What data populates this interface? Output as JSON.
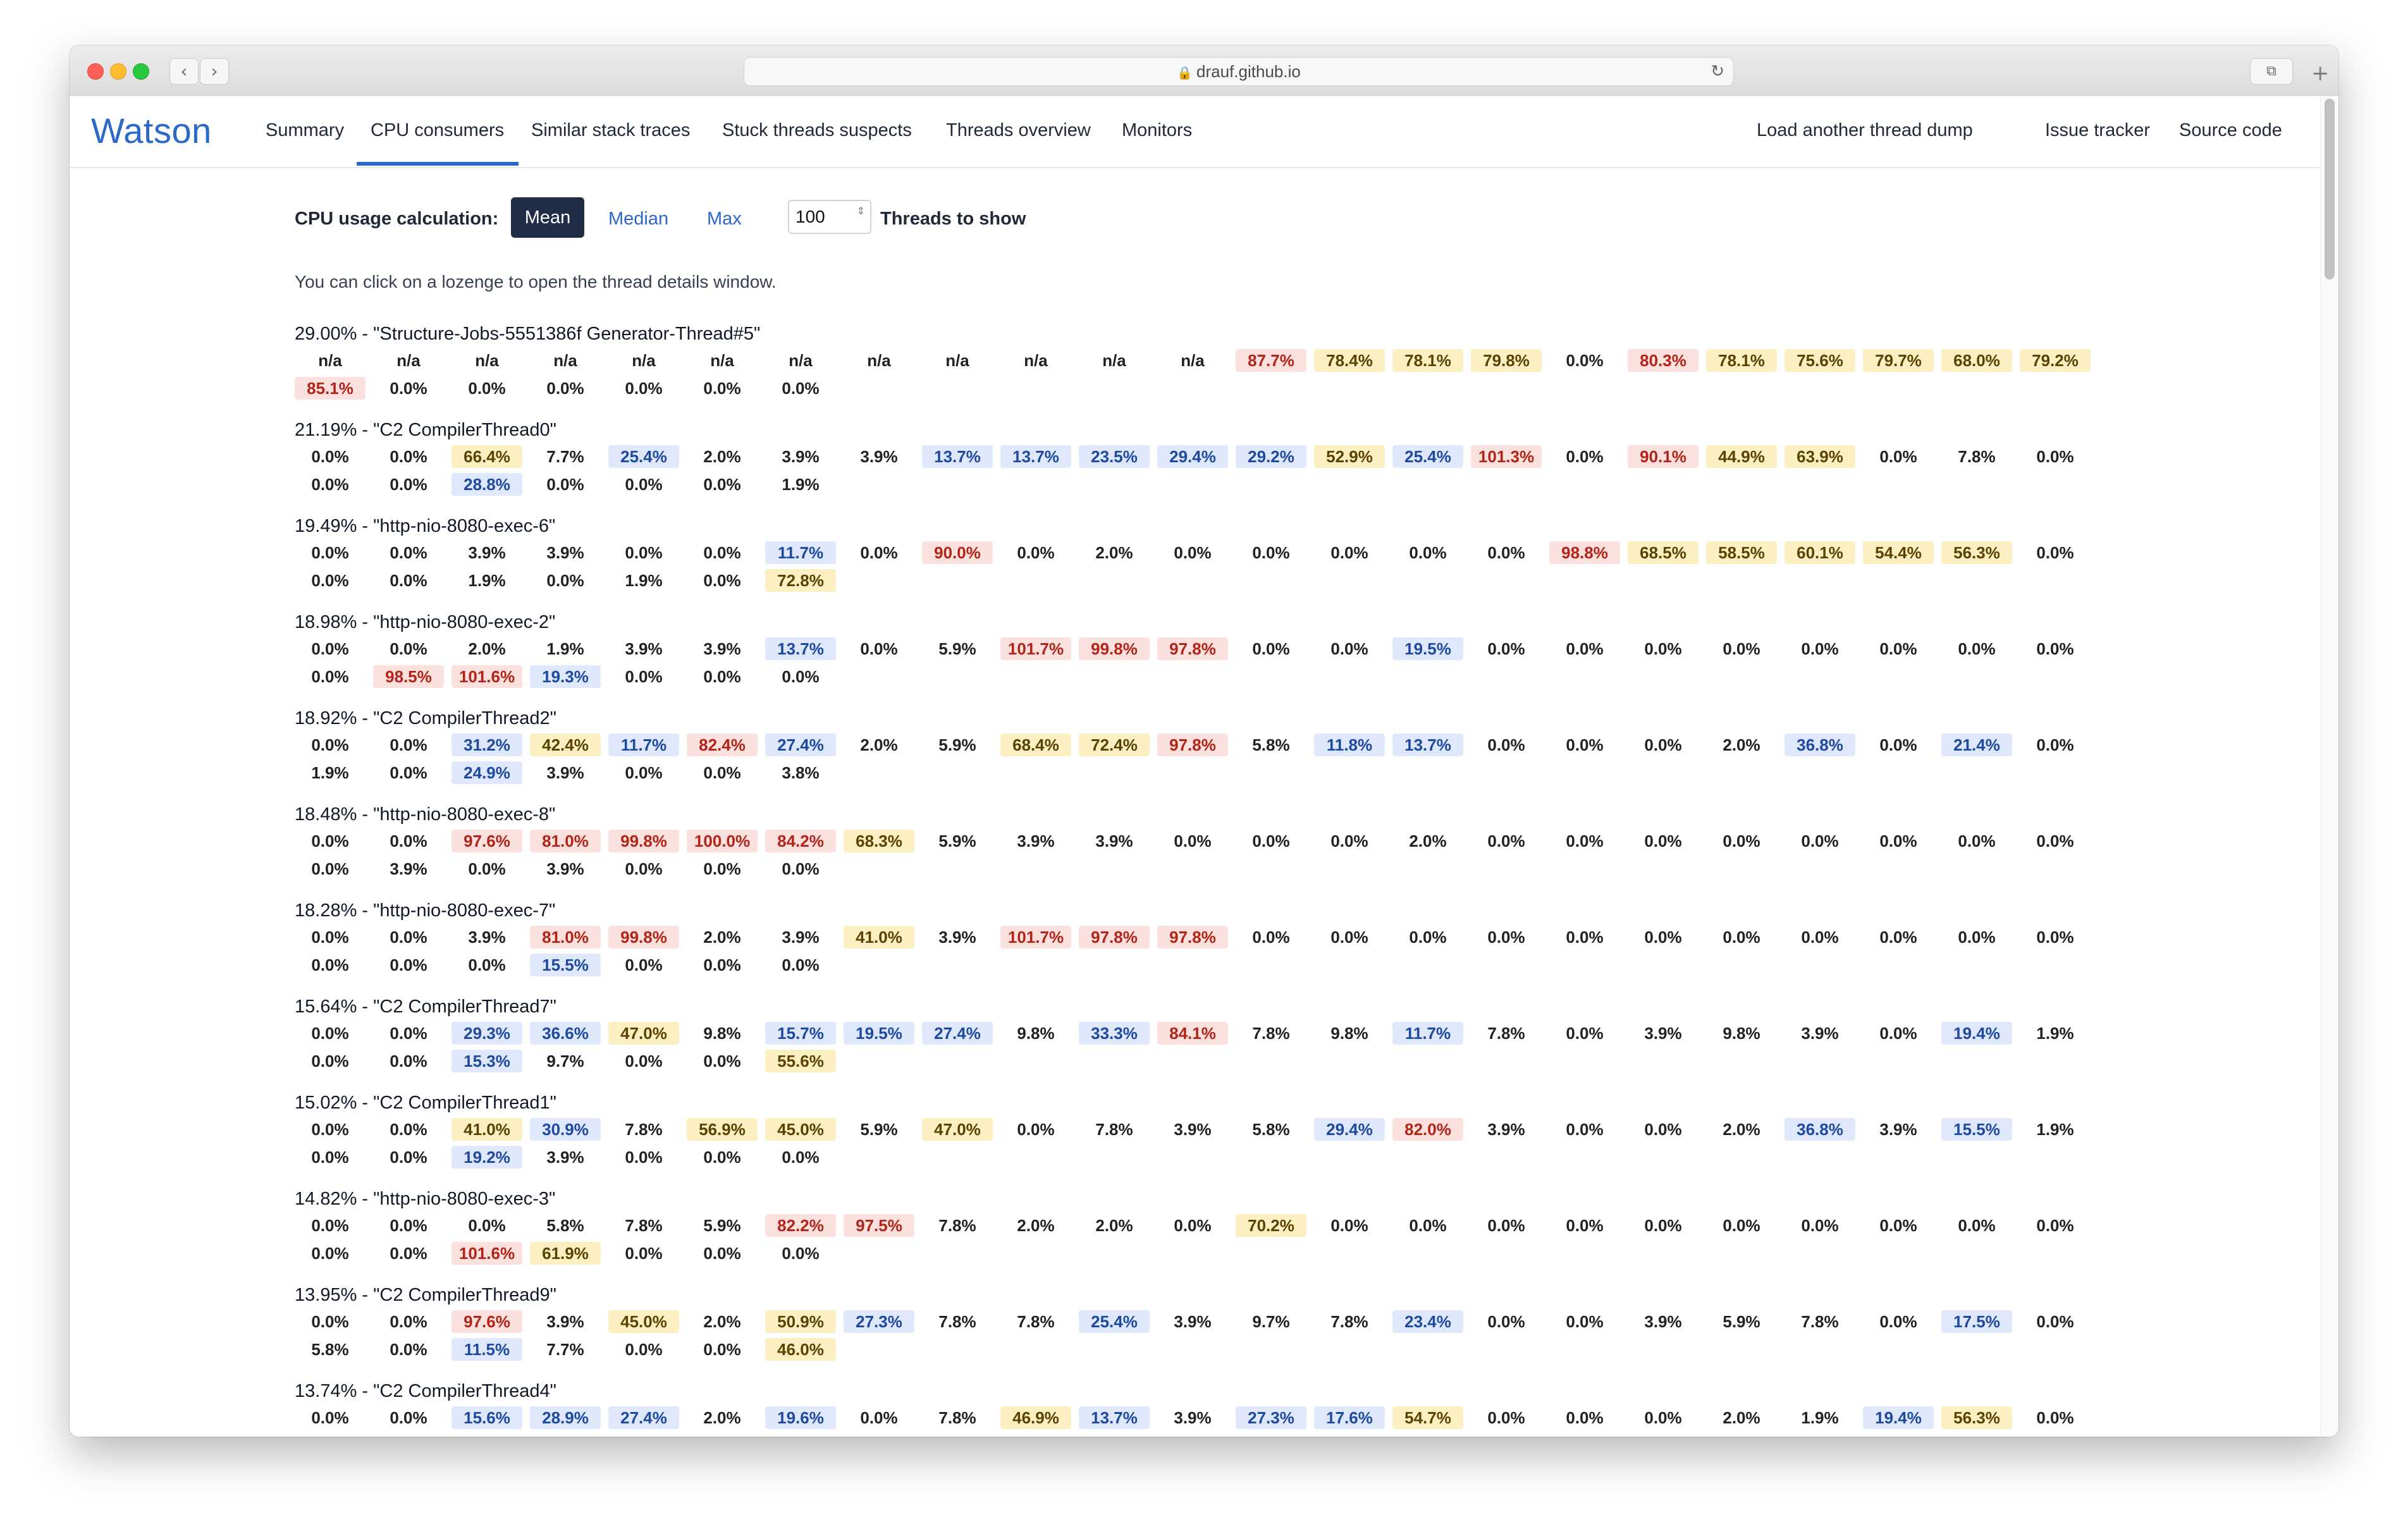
{
  "browser": {
    "url": "drauf.github.io",
    "back_icon": "‹",
    "forward_icon": "›",
    "reload_icon": "↻",
    "tabs_icon": "⧉",
    "new_tab_icon": "+",
    "lock_icon": "🔒"
  },
  "nav": {
    "brand": "Watson",
    "links": [
      "Summary",
      "CPU consumers",
      "Similar stack traces",
      "Stuck threads suspects",
      "Threads overview",
      "Monitors"
    ],
    "active": "CPU consumers",
    "right_links": [
      "Load another thread dump",
      "Issue tracker",
      "Source code"
    ]
  },
  "controls": {
    "label": "CPU usage calculation:",
    "options": [
      "Mean",
      "Median",
      "Max"
    ],
    "selected": "Mean",
    "threads_value": "100",
    "threads_label": "Threads to show",
    "stepper_icon": "⇕"
  },
  "hint": "You can click on a lozenge to open the thread details window.",
  "threads": [
    {
      "title": "29.00% - \"Structure-Jobs-5551386f Generator-Thread#5\"",
      "values": [
        "n/a",
        "n/a",
        "n/a",
        "n/a",
        "n/a",
        "n/a",
        "n/a",
        "n/a",
        "n/a",
        "n/a",
        "n/a",
        "n/a",
        "87.7%",
        "78.4%",
        "78.1%",
        "79.8%",
        "0.0%",
        "80.3%",
        "78.1%",
        "75.6%",
        "79.7%",
        "68.0%",
        "79.2%",
        "85.1%",
        "0.0%",
        "0.0%",
        "0.0%",
        "0.0%",
        "0.0%",
        "0.0%"
      ]
    },
    {
      "title": "21.19% - \"C2 CompilerThread0\"",
      "values": [
        "0.0%",
        "0.0%",
        "66.4%",
        "7.7%",
        "25.4%",
        "2.0%",
        "3.9%",
        "3.9%",
        "13.7%",
        "13.7%",
        "23.5%",
        "29.4%",
        "29.2%",
        "52.9%",
        "25.4%",
        "101.3%",
        "0.0%",
        "90.1%",
        "44.9%",
        "63.9%",
        "0.0%",
        "7.8%",
        "0.0%",
        "0.0%",
        "0.0%",
        "28.8%",
        "0.0%",
        "0.0%",
        "0.0%",
        "1.9%"
      ]
    },
    {
      "title": "19.49% - \"http-nio-8080-exec-6\"",
      "values": [
        "0.0%",
        "0.0%",
        "3.9%",
        "3.9%",
        "0.0%",
        "0.0%",
        "11.7%",
        "0.0%",
        "90.0%",
        "0.0%",
        "2.0%",
        "0.0%",
        "0.0%",
        "0.0%",
        "0.0%",
        "0.0%",
        "98.8%",
        "68.5%",
        "58.5%",
        "60.1%",
        "54.4%",
        "56.3%",
        "0.0%",
        "0.0%",
        "0.0%",
        "1.9%",
        "0.0%",
        "1.9%",
        "0.0%",
        "72.8%"
      ]
    },
    {
      "title": "18.98% - \"http-nio-8080-exec-2\"",
      "values": [
        "0.0%",
        "0.0%",
        "2.0%",
        "1.9%",
        "3.9%",
        "3.9%",
        "13.7%",
        "0.0%",
        "5.9%",
        "101.7%",
        "99.8%",
        "97.8%",
        "0.0%",
        "0.0%",
        "19.5%",
        "0.0%",
        "0.0%",
        "0.0%",
        "0.0%",
        "0.0%",
        "0.0%",
        "0.0%",
        "0.0%",
        "0.0%",
        "98.5%",
        "101.6%",
        "19.3%",
        "0.0%",
        "0.0%",
        "0.0%"
      ]
    },
    {
      "title": "18.92% - \"C2 CompilerThread2\"",
      "values": [
        "0.0%",
        "0.0%",
        "31.2%",
        "42.4%",
        "11.7%",
        "82.4%",
        "27.4%",
        "2.0%",
        "5.9%",
        "68.4%",
        "72.4%",
        "97.8%",
        "5.8%",
        "11.8%",
        "13.7%",
        "0.0%",
        "0.0%",
        "0.0%",
        "2.0%",
        "36.8%",
        "0.0%",
        "21.4%",
        "0.0%",
        "1.9%",
        "0.0%",
        "24.9%",
        "3.9%",
        "0.0%",
        "0.0%",
        "3.8%"
      ]
    },
    {
      "title": "18.48% - \"http-nio-8080-exec-8\"",
      "values": [
        "0.0%",
        "0.0%",
        "97.6%",
        "81.0%",
        "99.8%",
        "100.0%",
        "84.2%",
        "68.3%",
        "5.9%",
        "3.9%",
        "3.9%",
        "0.0%",
        "0.0%",
        "0.0%",
        "2.0%",
        "0.0%",
        "0.0%",
        "0.0%",
        "0.0%",
        "0.0%",
        "0.0%",
        "0.0%",
        "0.0%",
        "0.0%",
        "3.9%",
        "0.0%",
        "3.9%",
        "0.0%",
        "0.0%",
        "0.0%"
      ]
    },
    {
      "title": "18.28% - \"http-nio-8080-exec-7\"",
      "values": [
        "0.0%",
        "0.0%",
        "3.9%",
        "81.0%",
        "99.8%",
        "2.0%",
        "3.9%",
        "41.0%",
        "3.9%",
        "101.7%",
        "97.8%",
        "97.8%",
        "0.0%",
        "0.0%",
        "0.0%",
        "0.0%",
        "0.0%",
        "0.0%",
        "0.0%",
        "0.0%",
        "0.0%",
        "0.0%",
        "0.0%",
        "0.0%",
        "0.0%",
        "0.0%",
        "15.5%",
        "0.0%",
        "0.0%",
        "0.0%"
      ]
    },
    {
      "title": "15.64% - \"C2 CompilerThread7\"",
      "values": [
        "0.0%",
        "0.0%",
        "29.3%",
        "36.6%",
        "47.0%",
        "9.8%",
        "15.7%",
        "19.5%",
        "27.4%",
        "9.8%",
        "33.3%",
        "84.1%",
        "7.8%",
        "9.8%",
        "11.7%",
        "7.8%",
        "0.0%",
        "3.9%",
        "9.8%",
        "3.9%",
        "0.0%",
        "19.4%",
        "1.9%",
        "0.0%",
        "0.0%",
        "15.3%",
        "9.7%",
        "0.0%",
        "0.0%",
        "55.6%"
      ]
    },
    {
      "title": "15.02% - \"C2 CompilerThread1\"",
      "values": [
        "0.0%",
        "0.0%",
        "41.0%",
        "30.9%",
        "7.8%",
        "56.9%",
        "45.0%",
        "5.9%",
        "47.0%",
        "0.0%",
        "7.8%",
        "3.9%",
        "5.8%",
        "29.4%",
        "82.0%",
        "3.9%",
        "0.0%",
        "0.0%",
        "2.0%",
        "36.8%",
        "3.9%",
        "15.5%",
        "1.9%",
        "0.0%",
        "0.0%",
        "19.2%",
        "3.9%",
        "0.0%",
        "0.0%",
        "0.0%"
      ]
    },
    {
      "title": "14.82% - \"http-nio-8080-exec-3\"",
      "values": [
        "0.0%",
        "0.0%",
        "0.0%",
        "5.8%",
        "7.8%",
        "5.9%",
        "82.2%",
        "97.5%",
        "7.8%",
        "2.0%",
        "2.0%",
        "0.0%",
        "70.2%",
        "0.0%",
        "0.0%",
        "0.0%",
        "0.0%",
        "0.0%",
        "0.0%",
        "0.0%",
        "0.0%",
        "0.0%",
        "0.0%",
        "0.0%",
        "0.0%",
        "101.6%",
        "61.9%",
        "0.0%",
        "0.0%",
        "0.0%"
      ]
    },
    {
      "title": "13.95% - \"C2 CompilerThread9\"",
      "values": [
        "0.0%",
        "0.0%",
        "97.6%",
        "3.9%",
        "45.0%",
        "2.0%",
        "50.9%",
        "27.3%",
        "7.8%",
        "7.8%",
        "25.4%",
        "3.9%",
        "9.7%",
        "7.8%",
        "23.4%",
        "0.0%",
        "0.0%",
        "3.9%",
        "5.9%",
        "7.8%",
        "0.0%",
        "17.5%",
        "0.0%",
        "5.8%",
        "0.0%",
        "11.5%",
        "7.7%",
        "0.0%",
        "0.0%",
        "46.0%"
      ]
    },
    {
      "title": "13.74% - \"C2 CompilerThread4\"",
      "values": [
        "0.0%",
        "0.0%",
        "15.6%",
        "28.9%",
        "27.4%",
        "2.0%",
        "19.6%",
        "0.0%",
        "7.8%",
        "46.9%",
        "13.7%",
        "3.9%",
        "27.3%",
        "17.6%",
        "54.7%",
        "0.0%",
        "0.0%",
        "0.0%",
        "2.0%",
        "1.9%",
        "19.4%",
        "56.3%",
        "0.0%"
      ]
    }
  ],
  "colors": {
    "high": "#fbe1de",
    "medium": "#fcefc2",
    "low": "#dfe8fb",
    "accent": "#2a68c9",
    "selected_button": "#1f2d47"
  }
}
